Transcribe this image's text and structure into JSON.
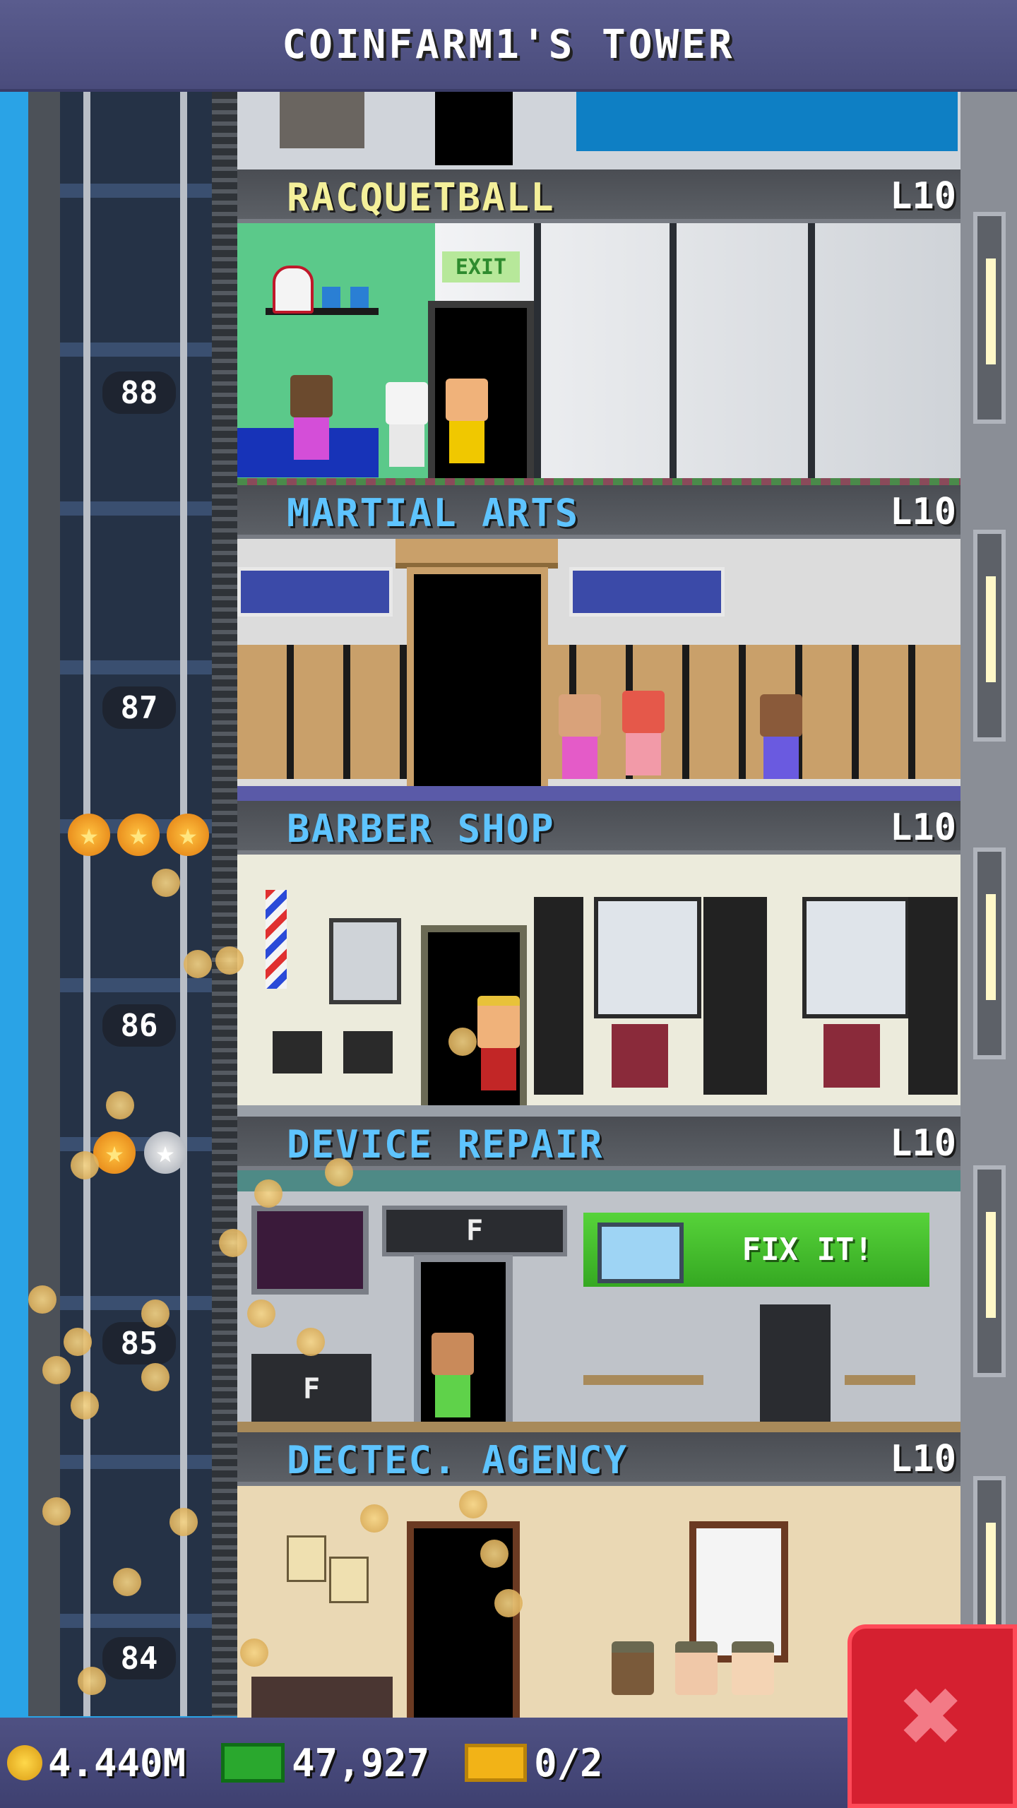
{
  "header": {
    "title": "COINFARM1'S TOWER"
  },
  "elevator": {
    "floor_numbers": [
      "88",
      "87",
      "86",
      "85",
      "84"
    ],
    "ratings": [
      {
        "floor": "87",
        "stars": [
          "gold",
          "gold",
          "gold"
        ],
        "symbol": "★"
      },
      {
        "floor": "86",
        "stars": [
          "gold",
          "silver"
        ],
        "symbol": "★"
      }
    ]
  },
  "floors": [
    {
      "name": "RACQUETBALL",
      "level": "L10",
      "name_color": "#f4f09a",
      "sign": "EXIT"
    },
    {
      "name": "MARTIAL ARTS",
      "level": "L10",
      "name_color": "#5ec4ff"
    },
    {
      "name": "BARBER SHOP",
      "level": "L10",
      "name_color": "#5ec4ff"
    },
    {
      "name": "DEVICE REPAIR",
      "level": "L10",
      "name_color": "#5ec4ff",
      "screen_label": "F",
      "counter_label": "F",
      "sign": "FIX IT!"
    },
    {
      "name": "DECTEC. AGENCY",
      "level": "L10",
      "name_color": "#5ec4ff"
    }
  ],
  "footer": {
    "coins": "4.440M",
    "bux": "47,927",
    "tickets": "0/2"
  },
  "close_button": {
    "label": "✖",
    "icon": "close-icon"
  }
}
